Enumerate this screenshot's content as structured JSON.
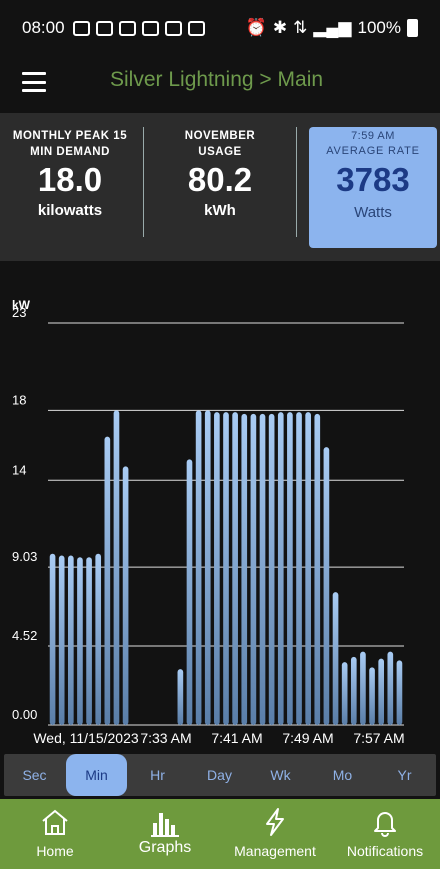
{
  "status_bar": {
    "time": "08:00",
    "battery": "100%"
  },
  "app_bar": {
    "title": "Silver Lightning > Main"
  },
  "stats": {
    "peak": {
      "label_line1": "MONTHLY PEAK 15",
      "label_line2": "MIN DEMAND",
      "value": "18.0",
      "unit": "kilowatts"
    },
    "usage": {
      "label_line1": "NOVEMBER",
      "label_line2": "USAGE",
      "value": "80.2",
      "unit": "kWh"
    },
    "rate": {
      "time": "7:59 AM",
      "label": "AVERAGE RATE",
      "value": "3783",
      "unit": "Watts"
    }
  },
  "chart_data": {
    "type": "bar",
    "ylabel": "kW",
    "y_ticks": [
      "23",
      "18",
      "14",
      "9.03",
      "4.52",
      "0.00"
    ],
    "y_tick_values": [
      23,
      18,
      14,
      9.03,
      4.52,
      0
    ],
    "ylim": [
      0,
      23
    ],
    "x_tick_labels": [
      "Wed, 11/15/2023",
      "7:33 AM",
      "7:41 AM",
      "7:49 AM",
      "7:57 AM"
    ],
    "grid": true,
    "bar_color": "#9ec3f0",
    "values": [
      9.8,
      9.7,
      9.7,
      9.6,
      9.6,
      9.8,
      16.5,
      18.0,
      14.8,
      null,
      null,
      null,
      null,
      null,
      3.2,
      15.2,
      18.0,
      18.0,
      17.9,
      17.9,
      17.9,
      17.8,
      17.8,
      17.8,
      17.8,
      17.9,
      17.9,
      17.9,
      17.9,
      17.8,
      15.9,
      7.6,
      3.6,
      3.9,
      4.2,
      3.3,
      3.8,
      4.2,
      3.7
    ]
  },
  "tabs": {
    "items": [
      "Sec",
      "Min",
      "Hr",
      "Day",
      "Wk",
      "Mo",
      "Yr"
    ],
    "active": "Min"
  },
  "bottom_nav": {
    "home": "Home",
    "graphs": "Graphs",
    "management": "Management",
    "notifications": "Notifications"
  }
}
